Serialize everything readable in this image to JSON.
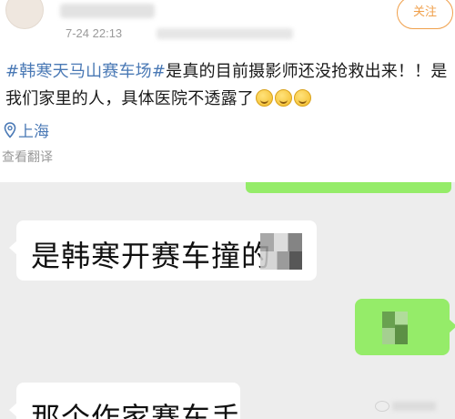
{
  "post": {
    "time": "7-24 22:13",
    "follow_label": "关注",
    "topic": "#韩寒天马山赛车场#",
    "body_text": "是真的目前摄影师还没抢救出来！！是我们家里的人，具体医院不透露了",
    "emojis": [
      "doge-emoji",
      "doge-emoji",
      "doge-emoji"
    ],
    "location": "上海",
    "translate_label": "查看翻译"
  },
  "chat": {
    "messages": [
      {
        "side": "left",
        "text": "是韩寒开赛车撞的",
        "redacted": true
      },
      {
        "side": "right",
        "text": "",
        "redacted": true
      },
      {
        "side": "left",
        "text": "那个作家赛车手",
        "redacted": false
      }
    ]
  },
  "colors": {
    "topic_blue": "#4a79b5",
    "follow_orange": "#f0a04b",
    "wechat_green": "#95ec69",
    "chat_bg": "#ededed"
  }
}
